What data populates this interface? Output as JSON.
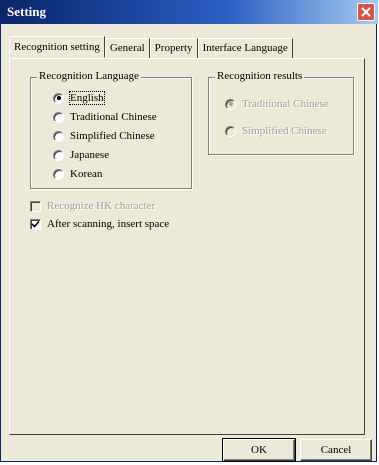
{
  "window": {
    "title": "Setting"
  },
  "tabs": [
    {
      "label": "Recognition setting"
    },
    {
      "label": "General"
    },
    {
      "label": "Property"
    },
    {
      "label": "Interface Language"
    }
  ],
  "recognition_language": {
    "title": "Recognition Language",
    "selected": "English",
    "options": [
      {
        "label": "English"
      },
      {
        "label": "Traditional Chinese"
      },
      {
        "label": "Simplified Chinese"
      },
      {
        "label": "Japanese"
      },
      {
        "label": "Korean"
      }
    ]
  },
  "recognition_results": {
    "title": "Recognition results",
    "selected": "Traditional Chinese",
    "options": [
      {
        "label": "Traditional Chinese"
      },
      {
        "label": "Simplified Chinese"
      }
    ]
  },
  "options": {
    "hk_character_label": "Recognize HK character",
    "insert_space_label": "After scanning, insert space"
  },
  "buttons": {
    "ok": "OK",
    "cancel": "Cancel"
  },
  "colors": {
    "title_start": "#0a246a",
    "title_end": "#a6caf0",
    "face": "#ece9d8",
    "close": "#d4544a"
  },
  "icons": {
    "close": "close-icon",
    "check": "check-icon"
  }
}
